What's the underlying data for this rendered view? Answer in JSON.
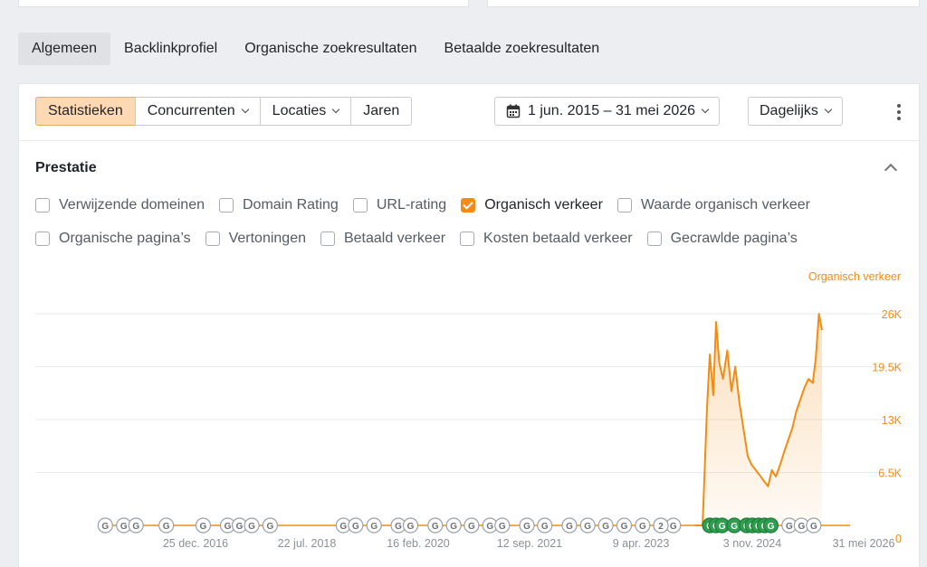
{
  "tabs": [
    {
      "label": "Algemeen",
      "active": true
    },
    {
      "label": "Backlinkprofiel",
      "active": false
    },
    {
      "label": "Organische zoekresultaten",
      "active": false
    },
    {
      "label": "Betaalde zoekresultaten",
      "active": false
    }
  ],
  "toolbar": {
    "segments": [
      {
        "label": "Statistieken",
        "active": true
      },
      {
        "label": "Concurrenten",
        "dropdown": true
      },
      {
        "label": "Locaties",
        "dropdown": true
      },
      {
        "label": "Jaren"
      }
    ],
    "date_range": "1 jun. 2015 – 31 mei 2026",
    "frequency": "Dagelijks"
  },
  "section": {
    "title": "Prestatie",
    "metrics_row1": [
      {
        "label": "Verwijzende domeinen",
        "checked": false
      },
      {
        "label": "Domain Rating",
        "checked": false
      },
      {
        "label": "URL-rating",
        "checked": false
      },
      {
        "label": "Organisch verkeer",
        "checked": true
      },
      {
        "label": "Waarde organisch verkeer",
        "checked": false
      }
    ],
    "metrics_row2": [
      {
        "label": "Organische pagina’s",
        "checked": false
      },
      {
        "label": "Vertoningen",
        "checked": false
      },
      {
        "label": "Betaald verkeer",
        "checked": false
      },
      {
        "label": "Kosten betaald verkeer",
        "checked": false
      },
      {
        "label": "Gecrawlde pagina’s",
        "checked": false
      }
    ]
  },
  "colors": {
    "accent": "#f38c12",
    "marker_green": "#2e9e4f"
  },
  "chart_data": {
    "type": "area",
    "series": [
      {
        "name": "Organisch verkeer",
        "x": [
          "2024-06-01",
          "2024-06-20",
          "2024-07-10",
          "2024-08-01",
          "2024-08-15",
          "2024-09-01",
          "2024-09-15",
          "2024-10-01",
          "2024-10-20",
          "2024-11-10",
          "2024-12-01",
          "2024-12-20",
          "2025-01-10",
          "2025-02-01",
          "2025-02-20",
          "2025-03-10",
          "2025-04-01",
          "2025-04-20",
          "2025-05-10",
          "2025-06-01",
          "2025-06-20",
          "2025-07-10",
          "2025-08-01",
          "2025-08-20",
          "2025-09-10",
          "2025-10-01",
          "2025-10-20",
          "2025-11-10",
          "2025-12-01",
          "2025-12-20",
          "2026-01-10",
          "2026-01-25",
          "2026-02-10",
          "2026-02-25"
        ],
        "values": [
          0,
          0,
          0,
          14500,
          21000,
          16000,
          25000,
          20000,
          18000,
          21500,
          16500,
          19500,
          15000,
          11500,
          8500,
          7500,
          6800,
          6200,
          5500,
          4800,
          6800,
          6000,
          7500,
          9000,
          10500,
          12000,
          14000,
          15500,
          17000,
          18000,
          17500,
          20500,
          26000,
          24000
        ]
      }
    ],
    "x_ticks": [
      "25 dec. 2016",
      "22 jul. 2018",
      "16 feb. 2020",
      "12 sep. 2021",
      "9 apr. 2023",
      "3 nov. 2024",
      "31 mei 2026"
    ],
    "y_ticks": [
      "0",
      "6.5K",
      "13K",
      "19.5K",
      "26K"
    ],
    "ylim": [
      0,
      26000
    ],
    "xlim": [
      "2015-06-01",
      "2026-05-31"
    ],
    "annotation_markers": {
      "label": "G",
      "gray_dates": [
        "2016-05",
        "2016-08",
        "2016-10",
        "2017-03",
        "2017-09",
        "2018-01",
        "2018-03",
        "2018-05",
        "2018-08",
        "2019-08",
        "2019-10",
        "2020-01",
        "2020-05",
        "2020-07",
        "2020-11",
        "2021-02",
        "2021-05",
        "2021-08",
        "2021-10",
        "2022-02",
        "2022-05",
        "2022-09",
        "2022-12",
        "2023-03",
        "2023-06",
        "2023-09",
        "2023-12",
        "2024-02",
        "2025-09",
        "2025-11",
        "2026-01"
      ],
      "green_dates": [
        "2024-08",
        "2024-09",
        "2024-10",
        "2024-12",
        "2025-02",
        "2025-03",
        "2025-04",
        "2025-05",
        "2025-06"
      ],
      "numbered": {
        "date": "2023-12",
        "label": "2"
      }
    },
    "grid": true,
    "legend": "top-right"
  }
}
